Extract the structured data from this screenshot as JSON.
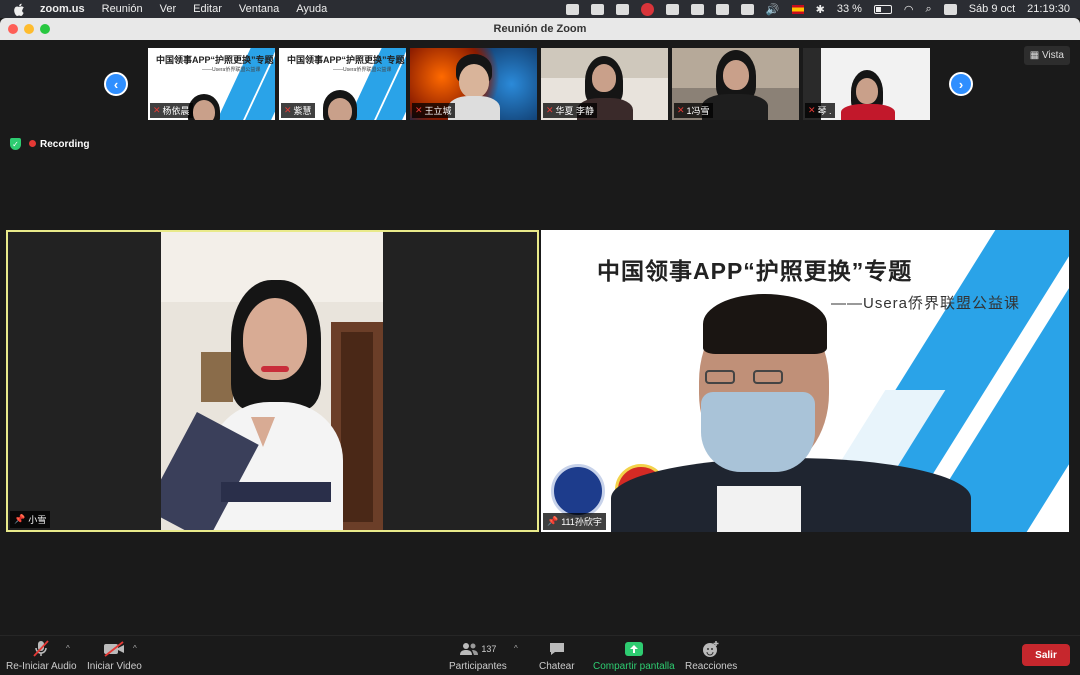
{
  "menubar": {
    "app": "zoom.us",
    "items": [
      "Reunión",
      "Ver",
      "Editar",
      "Ventana",
      "Ayuda"
    ],
    "battery": "33 %",
    "date": "Sáb 9 oct",
    "time": "21:19:30"
  },
  "window": {
    "title": "Reunión de Zoom"
  },
  "gallery": {
    "thumbs": [
      {
        "name": "杨依晨",
        "slide_title": "中国领事APP“护照更换”专题",
        "slide_sub": "——Usera侨界联盟公益课"
      },
      {
        "name": "紫慧",
        "slide_title": "中国领事APP“护照更换”专题",
        "slide_sub": "——Usera侨界联盟公益课"
      },
      {
        "name": "王立城"
      },
      {
        "name": "华夏 李静"
      },
      {
        "name": "1冯雪"
      },
      {
        "name": "琴 ."
      }
    ],
    "view_label": "Vista"
  },
  "status": {
    "recording_label": "Recording"
  },
  "main": {
    "left_name": "小雪",
    "right_name": "111孙欣宇",
    "slide_title": "中国领事APP“护照更换”专题",
    "slide_subtitle": "——Usera侨界联盟公益课"
  },
  "toolbar": {
    "audio_label": "Re-Iniciar Audio",
    "video_label": "Iniciar Video",
    "participants_label": "Participantes",
    "participants_count": "137",
    "chat_label": "Chatear",
    "share_label": "Compartir pantalla",
    "reactions_label": "Reacciones",
    "leave_label": "Salir"
  },
  "colors": {
    "accent_blue": "#2f8fff",
    "leave_red": "#c6272d",
    "share_green": "#2ecc71",
    "active_border": "#e9ea8a",
    "slide_blue": "#2aa3e8"
  }
}
